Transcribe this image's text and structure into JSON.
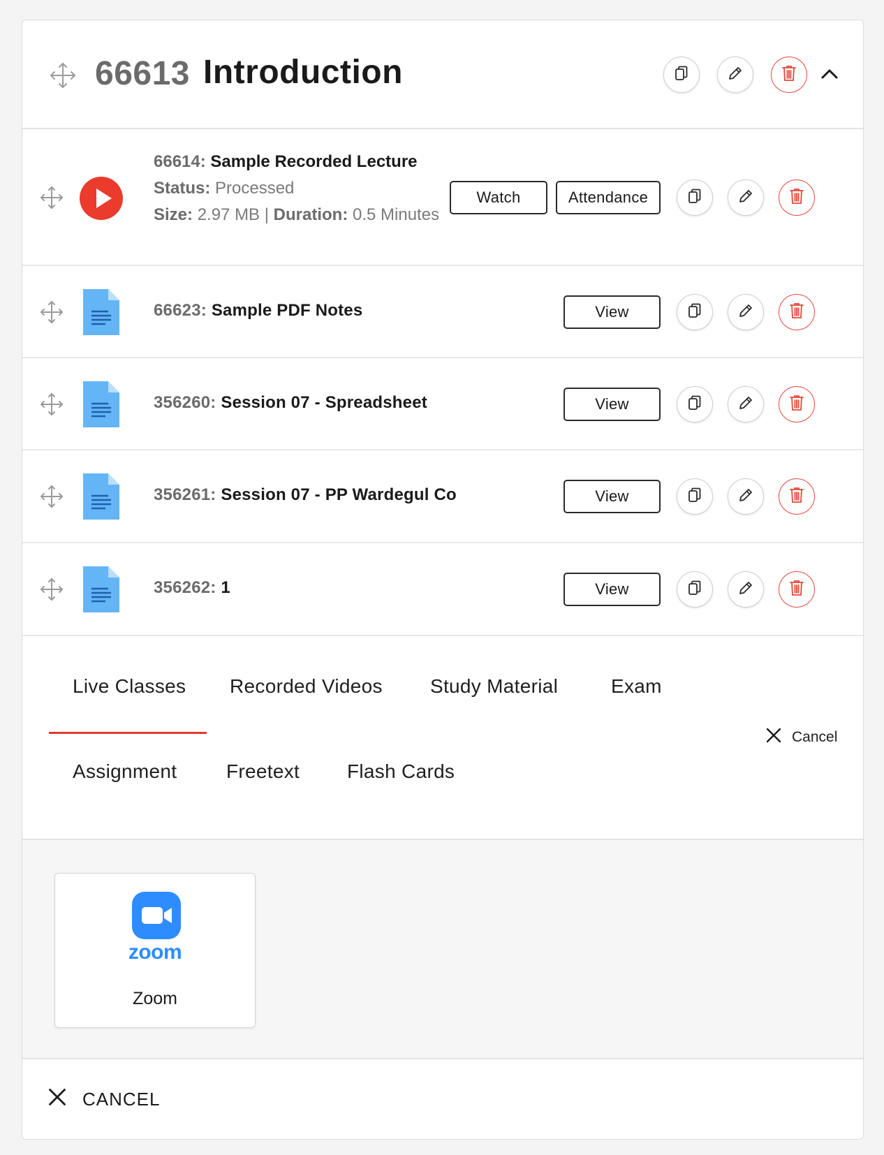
{
  "colors": {
    "accent_red": "#e03a2f",
    "delete_red": "#e4473b",
    "zoom_blue": "#2d8cff",
    "doc_blue": "#64b5f6"
  },
  "header": {
    "id": "66613",
    "title": "Introduction",
    "actions": [
      "copy-icon",
      "edit-icon",
      "trash-icon",
      "chevron-up-icon"
    ]
  },
  "lecture": {
    "id_label": "66614:",
    "title": "Sample Recorded Lecture",
    "status_label": "Status:",
    "status_value": "Processed",
    "size_label": "Size:",
    "size_value": "2.97 MB",
    "separator": "|",
    "duration_label": "Duration:",
    "duration_value": "0.5",
    "duration_unit": "Minutes",
    "watch_label": "Watch",
    "attendance_label": "Attendance"
  },
  "items": [
    {
      "id_label": "66623:",
      "title": "Sample PDF Notes",
      "view_label": "View"
    },
    {
      "id_label": "356260:",
      "title": "Session 07 - Spreadsheet",
      "view_label": "View"
    },
    {
      "id_label": "356261:",
      "title": "Session 07 - PP Wardegul Co",
      "view_label": "View"
    },
    {
      "id_label": "356262:",
      "title": "1",
      "view_label": "View"
    }
  ],
  "tabs": {
    "row1": [
      "Live Classes",
      "Recorded Videos",
      "Study Material",
      "Exam"
    ],
    "row2": [
      "Assignment",
      "Freetext",
      "Flash Cards"
    ],
    "active": "Live Classes",
    "cancel_label": "Cancel"
  },
  "integration": {
    "logo_word": "zoom",
    "label": "Zoom"
  },
  "footer": {
    "cancel_label": "CANCEL"
  }
}
